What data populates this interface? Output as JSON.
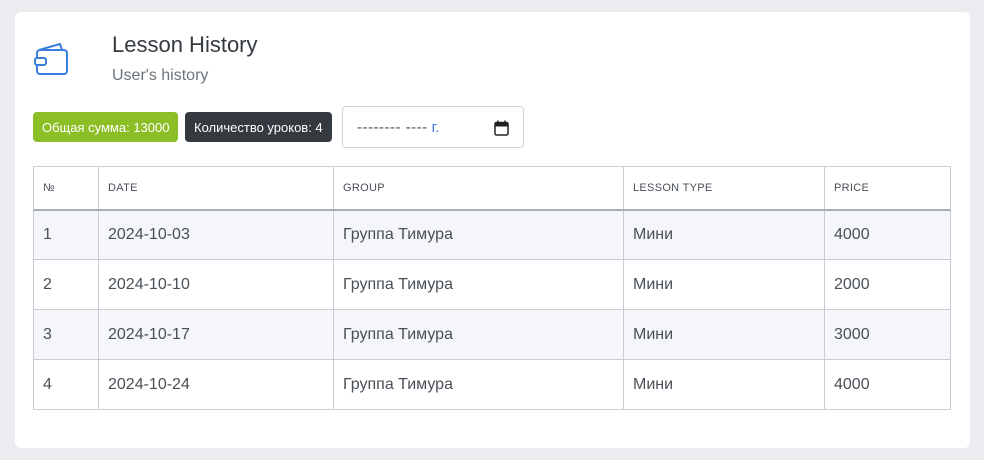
{
  "header": {
    "title": "Lesson History",
    "subtitle": "User's history",
    "icon": "wallet-icon",
    "accent": "#3b7ddd"
  },
  "filters": {
    "total_badge": "Общая сумма: 13000",
    "total_badge_color": "#8cbf26",
    "count_badge": "Количество уроков: 4",
    "count_badge_color": "#343a40",
    "date_placeholder": "-------- ----",
    "date_suffix": "г.",
    "date_icon": "calendar-icon"
  },
  "table": {
    "columns": [
      "№",
      "DATE",
      "GROUP",
      "LESSON TYPE",
      "PRICE"
    ],
    "rows": [
      [
        "1",
        "2024-10-03",
        "Группа Тимура",
        "Мини",
        "4000"
      ],
      [
        "2",
        "2024-10-10",
        "Группа Тимура",
        "Мини",
        "2000"
      ],
      [
        "3",
        "2024-10-17",
        "Группа Тимура",
        "Мини",
        "3000"
      ],
      [
        "4",
        "2024-10-24",
        "Группа Тимура",
        "Мини",
        "4000"
      ]
    ]
  }
}
